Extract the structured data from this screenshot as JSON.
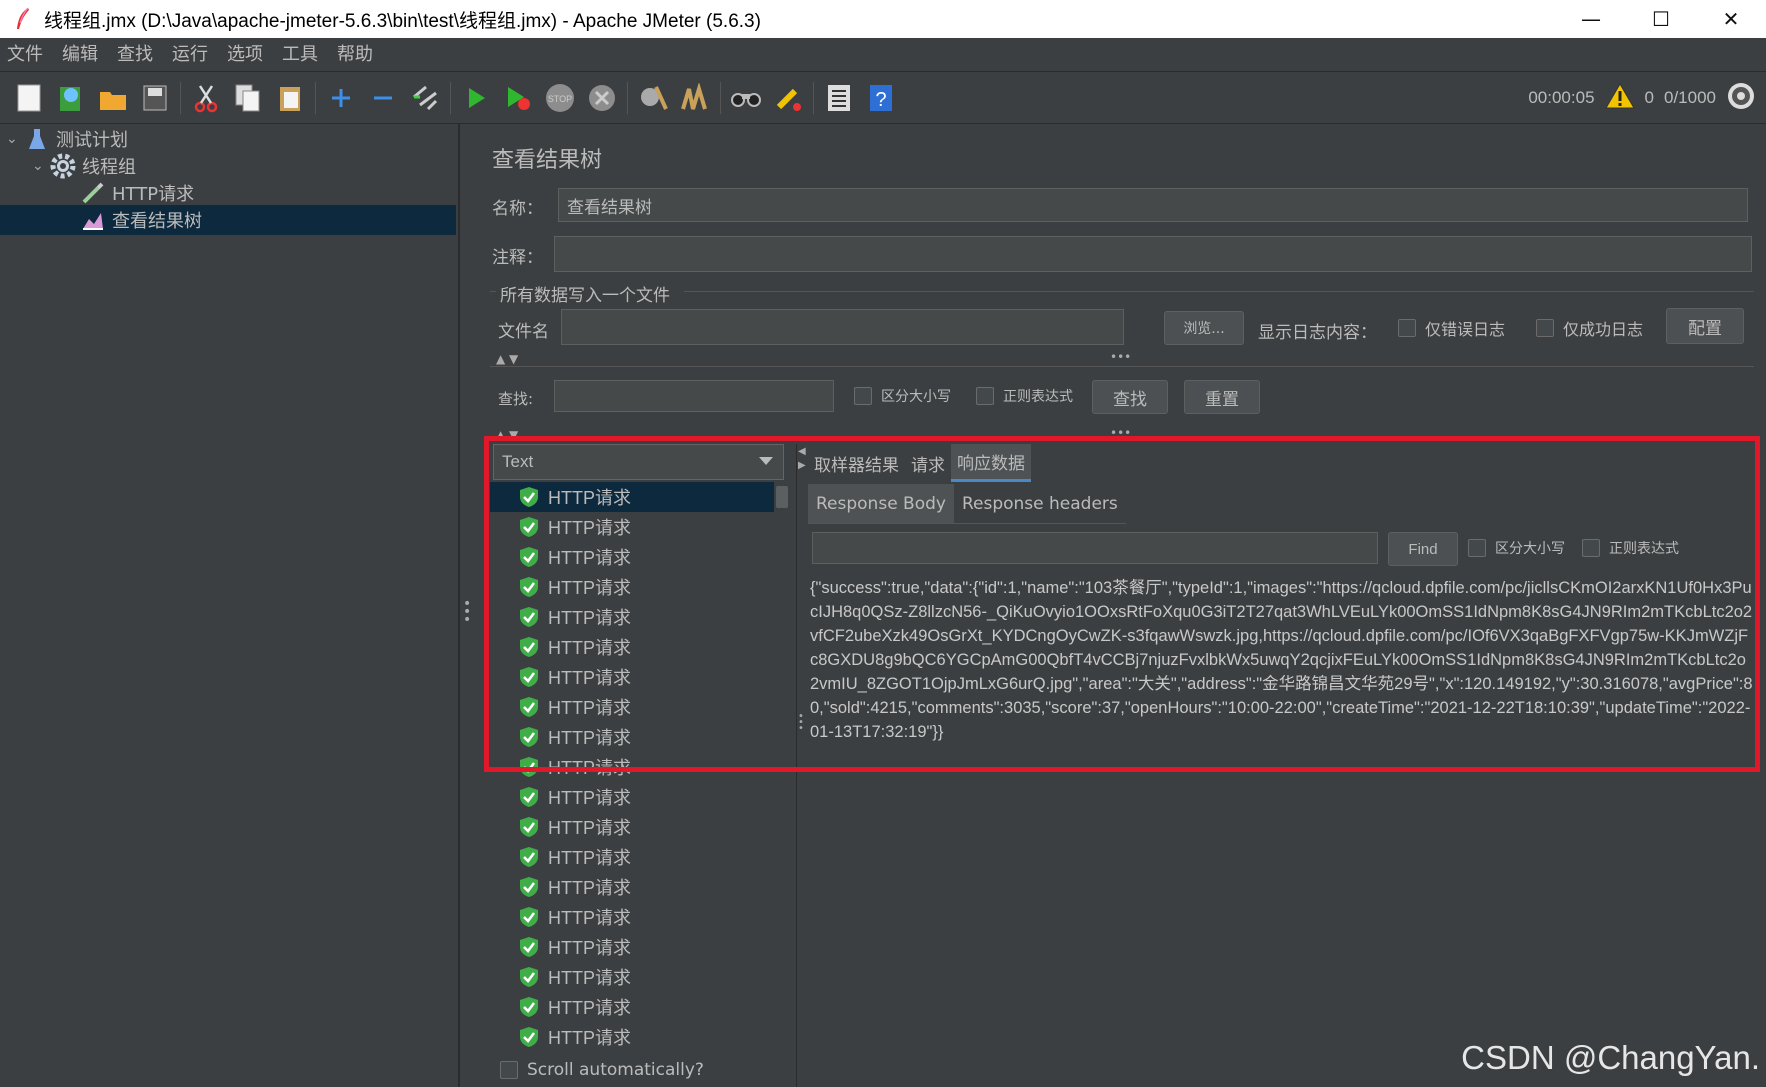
{
  "window": {
    "title": "线程组.jmx (D:\\Java\\apache-jmeter-5.6.3\\bin\\test\\线程组.jmx) - Apache JMeter (5.6.3)",
    "minimize": "—",
    "maximize": "☐",
    "close": "✕"
  },
  "menu": [
    "文件",
    "编辑",
    "查找",
    "运行",
    "选项",
    "工具",
    "帮助"
  ],
  "toolbar": {
    "icons": [
      "new-icon",
      "templates-icon",
      "open-icon",
      "save-icon",
      "cut-icon",
      "copy-icon",
      "paste-icon",
      "expand-icon",
      "collapse-icon",
      "toggle-icon",
      "start-icon",
      "start-no-pause-icon",
      "stop-icon",
      "shutdown-icon",
      "clear-icon",
      "clear-all-icon",
      "search-icon",
      "reset-search-icon",
      "function-helper-icon",
      "help-icon"
    ],
    "elapsed": "00:00:05",
    "warnings": "0",
    "threads": "0/1000"
  },
  "tree": {
    "items": [
      {
        "label": "测试计划",
        "icon": "flask-icon"
      },
      {
        "label": "线程组",
        "icon": "gear-icon"
      },
      {
        "label": "HTTP请求",
        "icon": "pipette-icon"
      },
      {
        "label": "查看结果树",
        "icon": "chart-icon"
      }
    ]
  },
  "panel": {
    "title": "查看结果树",
    "name_label": "名称：",
    "name_value": "查看结果树",
    "comment_label": "注释：",
    "comment_value": "",
    "file_group": "所有数据写入一个文件",
    "filename_label": "文件名",
    "filename_value": "",
    "browse": "浏览...",
    "log_label": "显示日志内容：",
    "errors_only": "仅错误日志",
    "success_only": "仅成功日志",
    "configure": "配置",
    "search_label": "查找:",
    "search_value": "",
    "case_sensitive": "区分大小写",
    "regex": "正则表达式",
    "find": "查找",
    "reset": "重置"
  },
  "results": {
    "renderer": "Text",
    "samples": [
      "HTTP请求",
      "HTTP请求",
      "HTTP请求",
      "HTTP请求",
      "HTTP请求",
      "HTTP请求",
      "HTTP请求",
      "HTTP请求",
      "HTTP请求",
      "HTTP请求",
      "HTTP请求",
      "HTTP请求",
      "HTTP请求",
      "HTTP请求",
      "HTTP请求",
      "HTTP请求",
      "HTTP请求",
      "HTTP请求",
      "HTTP请求"
    ],
    "scroll_auto": "Scroll automatically?",
    "tabs": [
      "取样器结果",
      "请求",
      "响应数据"
    ],
    "subtabs": [
      "Response Body",
      "Response headers"
    ],
    "find_value": "",
    "find_button": "Find",
    "case_sensitive": "区分大小写",
    "regex": "正则表达式",
    "body": "{\"success\":true,\"data\":{\"id\":1,\"name\":\"103茶餐厅\",\"typeId\":1,\"images\":\"https://qcloud.dpfile.com/pc/jicllsCKmOI2arxKN1Uf0Hx3PucIJH8q0QSz-Z8llzcN56-_QiKuOvyio1OOxsRtFoXqu0G3iT2T27qat3WhLVEuLYk00OmSS1IdNpm8K8sG4JN9RIm2mTKcbLtc2o2vfCF2ubeXzk49OsGrXt_KYDCngOyCwZK-s3fqawWswzk.jpg,https://qcloud.dpfile.com/pc/IOf6VX3qaBgFXFVgp75w-KKJmWZjFc8GXDU8g9bQC6YGCpAmG00QbfT4vCCBj7njuzFvxlbkWx5uwqY2qcjixFEuLYk00OmSS1IdNpm8K8sG4JN9RIm2mTKcbLtc2o2vmIU_8ZGOT1OjpJmLxG6urQ.jpg\",\"area\":\"大关\",\"address\":\"金华路锦昌文华苑29号\",\"x\":120.149192,\"y\":30.316078,\"avgPrice\":80,\"sold\":4215,\"comments\":3035,\"score\":37,\"openHours\":\"10:00-22:00\",\"createTime\":\"2021-12-22T18:10:39\",\"updateTime\":\"2022-01-13T17:32:19\"}}"
  },
  "watermark": "CSDN @ChangYan.",
  "colors": {
    "highlight": "#e0182a",
    "background": "#3c3f41",
    "selection": "#0d293e",
    "ok_green": "#3fae49"
  }
}
